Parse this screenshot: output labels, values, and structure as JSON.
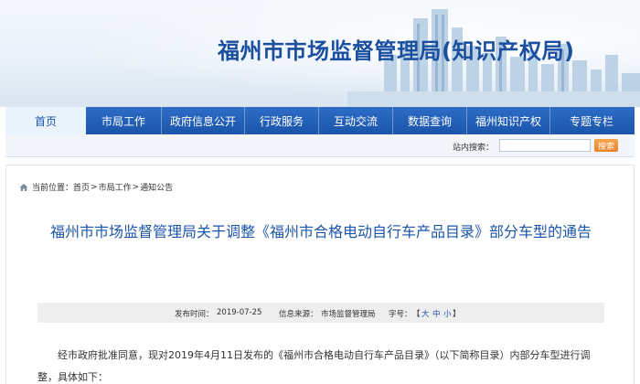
{
  "site": {
    "title": "福州市市场监督管理局(知识产权局)"
  },
  "nav": {
    "items": [
      {
        "label": "首页",
        "active": true
      },
      {
        "label": "市局工作"
      },
      {
        "label": "政府信息公开"
      },
      {
        "label": "行政服务"
      },
      {
        "label": "互动交流"
      },
      {
        "label": "数据查询"
      },
      {
        "label": "福州知识产权"
      },
      {
        "label": "专题专栏"
      }
    ]
  },
  "search": {
    "label": "站内搜索：",
    "value": "",
    "button_label": "搜索"
  },
  "breadcrumb": {
    "prefix": "当前位置：",
    "items": [
      "首页",
      "市局工作",
      "通知公告"
    ],
    "separator": ">"
  },
  "article": {
    "title": "福州市市场监督管理局关于调整《福州市合格电动自行车产品目录》部分车型的通告",
    "meta": {
      "date_label": "发布时间：",
      "date": "2019-07-25",
      "source_label": "信息来源：",
      "source": "市场监督管理局",
      "font_label": "字号：",
      "font_open": "【",
      "font_sizes": [
        "大",
        "中",
        "小"
      ],
      "font_close": "】"
    },
    "body": "经市政府批准同意，现对2019年4月11日发布的《福州市合格电动自行车产品目录》（以下简称目录）内部分车型进行调整，具体如下："
  },
  "colors": {
    "nav_bg": "#1b55ab",
    "title_blue": "#1a4fa0",
    "search_button": "#e9822a"
  }
}
